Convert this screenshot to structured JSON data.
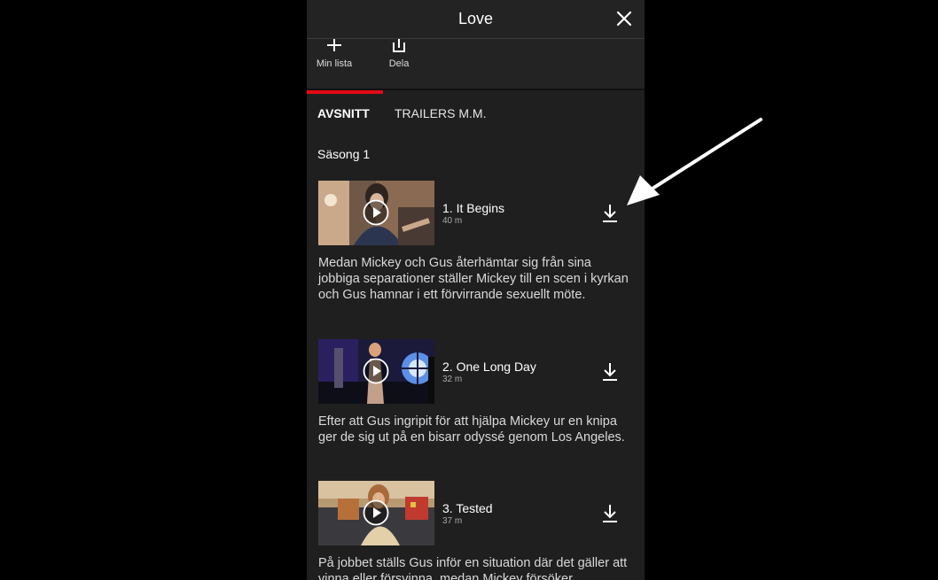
{
  "header": {
    "title": "Love",
    "close_icon": "close-icon"
  },
  "actions": [
    {
      "label": "Min lista",
      "icon": "plus-icon"
    },
    {
      "label": "Dela",
      "icon": "share-icon"
    }
  ],
  "tabs": [
    {
      "label": "AVSNITT",
      "active": true
    },
    {
      "label": "TRAILERS M.M.",
      "active": false
    }
  ],
  "season_label": "Säsong 1",
  "episodes": [
    {
      "title": "1. It Begins",
      "duration": "40 m",
      "description": "Medan Mickey och Gus återhämtar sig från sina jobbiga separationer ställer Mickey till en scen i kyrkan och Gus hamnar i ett förvirrande sexuellt möte."
    },
    {
      "title": "2. One Long Day",
      "duration": "32 m",
      "description": "Efter att Gus ingripit för att hjälpa Mickey ur en knipa ger de sig ut på en bisarr odyssé genom Los Angeles."
    },
    {
      "title": "3. Tested",
      "duration": "37 m",
      "description": "På jobbet ställs Gus inför en situation där det gäller att vinna eller försvinna, medan Mickey försöker"
    }
  ],
  "colors": {
    "accent": "#e50914",
    "background": "#1f1f1f",
    "annotation_arrow": "#ffffff"
  }
}
